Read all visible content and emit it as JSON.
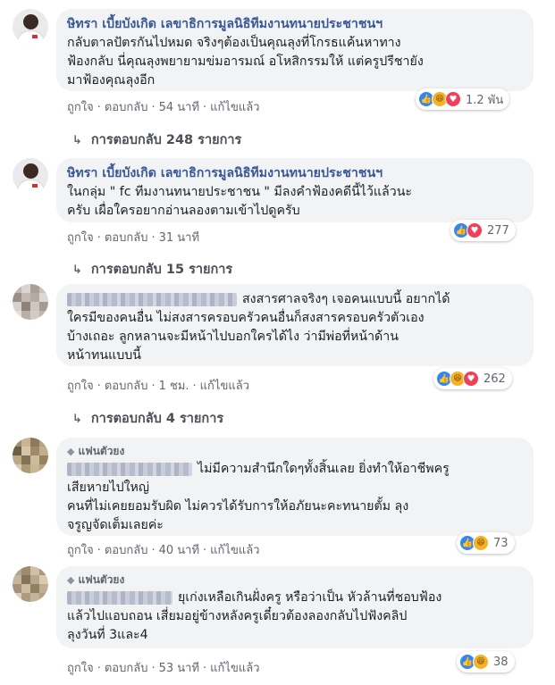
{
  "labels": {
    "like": "ถูกใจ",
    "reply": "ตอบกลับ",
    "edited": "แก้ไขแล้ว",
    "separator": "·"
  },
  "comments": [
    {
      "author": "ษิทรา เบี้ยบังเกิด เลขาธิการมูลนิธิทีมงานทนายประชาชนฯ",
      "lines": [
        "กลับตาลปัตรกันไปหมด จริงๆต้องเป็นคุณลุงที่โกรธแค้นหาทาง",
        "ฟ้องกลับ นี่คุณลุงพยายามข่มอารมณ์ อโหสิกรรมให้ แต่ครูปรีชายัง",
        "มาฟ้องคุณลุงอีก"
      ],
      "reactions": [
        "like",
        "haha",
        "love"
      ],
      "reaction_count": "1.2 พัน",
      "time": "54 นาที",
      "replies": "การตอบกลับ 248 รายการ"
    },
    {
      "author": "ษิทรา เบี้ยบังเกิด เลขาธิการมูลนิธิทีมงานทนายประชาชนฯ",
      "lines": [
        "ในกลุ่ม \" fc ทีมงานทนายประชาชน \" มีลงคำฟ้องคดีนี้ไว้แล้วนะ",
        "ครับ เผื่อใครอยากอ่านลองตามเข้าไปดูครับ"
      ],
      "reactions": [
        "like",
        "love"
      ],
      "reaction_count": "277",
      "time": "31 นาที",
      "replies": "การตอบกลับ 15 รายการ"
    },
    {
      "lines": [
        "สงสารศาลจริงๆ เจอคนแบบนี้ อยากได้",
        "ใครมีของคนอื่น ไม่สงสารครอบครัวคนอื่นก็สงสารครอบครัวตัวเอง",
        "บ้างเถอะ ลูกหลานจะมีหน้าไปบอกใครได้ไง ว่ามีพ่อที่หน้าด้าน",
        "หน้าทนแบบนี้"
      ],
      "reactions": [
        "like",
        "haha",
        "love"
      ],
      "reaction_count": "262",
      "time": "1 ชม.",
      "replies": "การตอบกลับ 4 รายการ"
    },
    {
      "badge": "แฟนตัวยง",
      "lines": [
        "ไม่มีความสำนึกใดๆทั้งสิ้นเลย ยิ่งทำให้อาชีพครู",
        "เสียหายไปใหญ่",
        "คนที่ไม่เคยยอมรับผิด ไม่ควรได้รับการให้อภัยนะคะทนายตั้ม ลุง",
        "จรูญจัดเต็มเลยค่ะ"
      ],
      "reactions": [
        "like",
        "haha"
      ],
      "reaction_count": "73",
      "time": "40 นาที"
    },
    {
      "badge": "แฟนตัวยง",
      "lines": [
        "ยุเก่งเหลือเกินฝั่งครู หรือว่าเป็น หัวล้านที่ชอบฟ้อง",
        "แล้วไปแอบถอน เสี่ยมอยู่ข้างหลังครูเดี๋ยวต้องลองกลับไปฟังคลิป",
        "ลุงวันที่ 3และ4"
      ],
      "reactions": [
        "like",
        "haha"
      ],
      "reaction_count": "38",
      "time": "53 นาที"
    }
  ],
  "colors": {
    "name": "#385898",
    "bubble": "#f2f3f5",
    "meta": "#606770",
    "like": "#2d88ff",
    "love": "#f33e58",
    "haha": "#f7b125"
  }
}
